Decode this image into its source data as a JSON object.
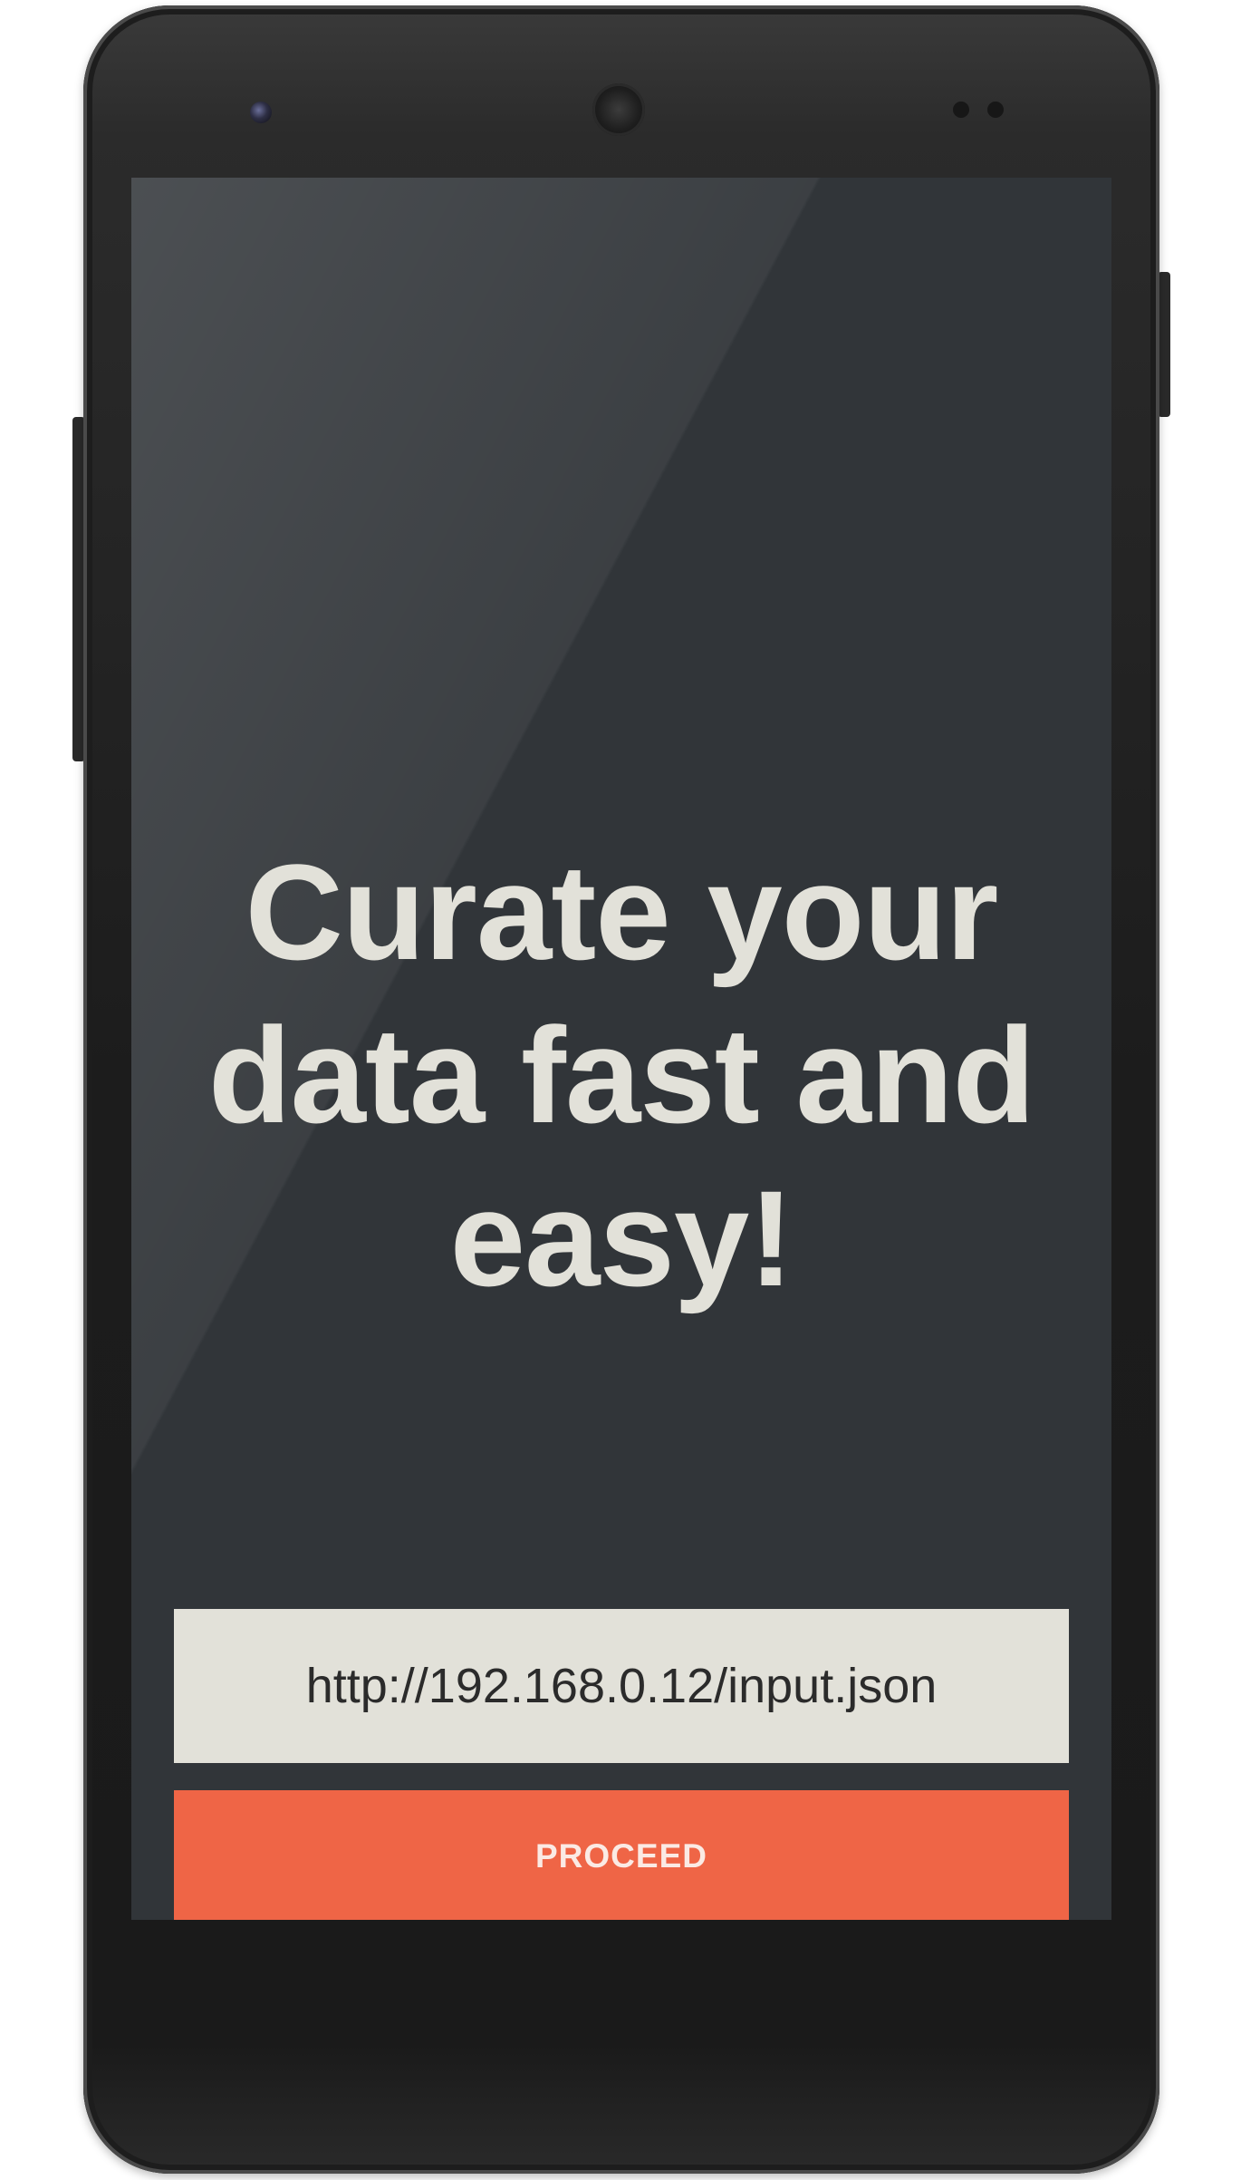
{
  "headline": {
    "line1": "Curate your",
    "line2": "data fast and",
    "line3": "easy!"
  },
  "url_field": {
    "value": "http://192.168.0.12/input.json"
  },
  "proceed_button": {
    "label": "PROCEED"
  },
  "colors": {
    "screen_background": "#313539",
    "headline_text": "#e2e1d9",
    "input_background": "#e2e1d9",
    "accent_button": "#ef6546"
  }
}
